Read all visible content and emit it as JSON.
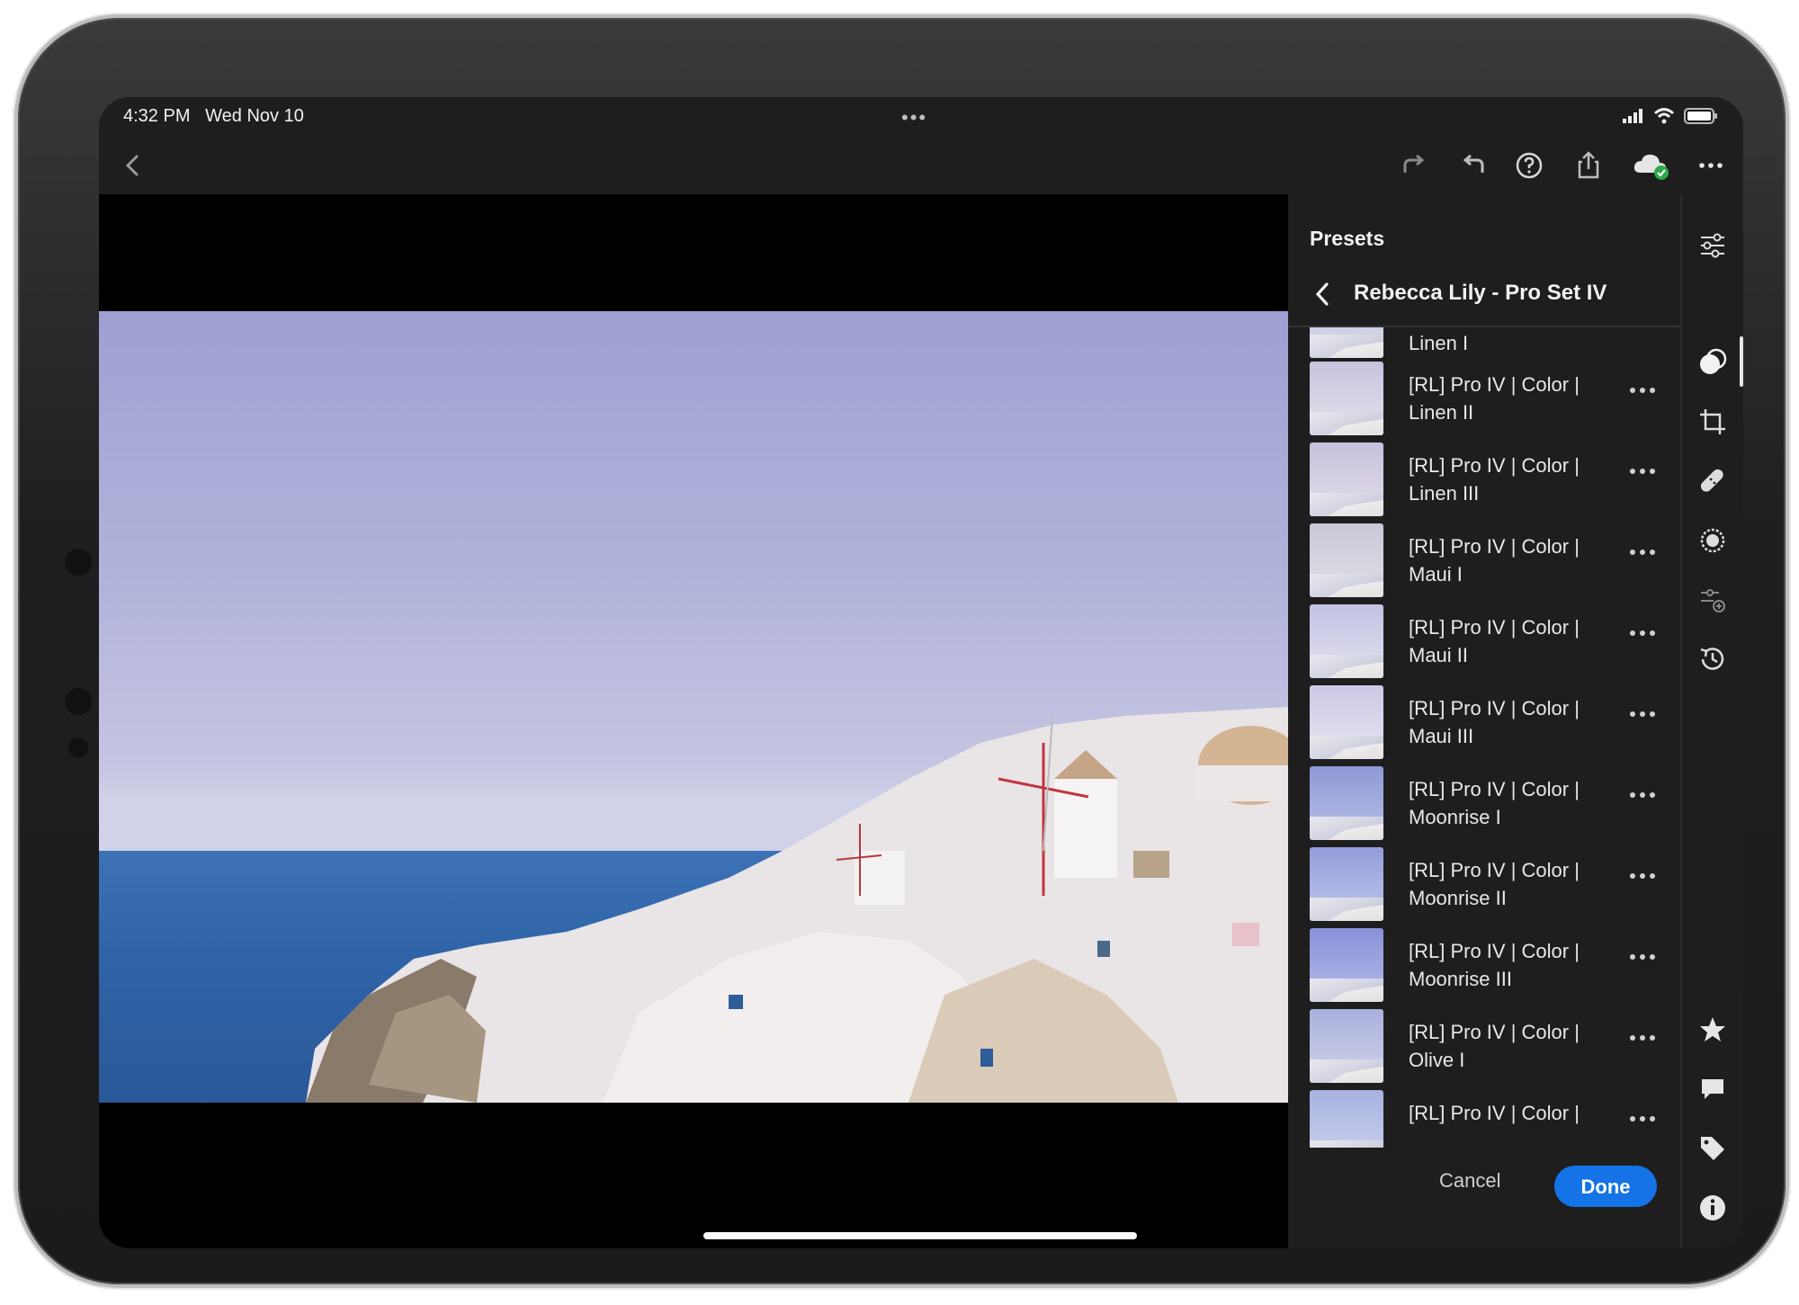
{
  "status_bar": {
    "time": "4:32 PM",
    "date": "Wed Nov 10",
    "dots": "•••"
  },
  "toolbar": {
    "icons": [
      "back-chevron-icon",
      "redo-icon",
      "undo-icon",
      "help-icon",
      "share-icon",
      "cloud-synced-icon",
      "more-icon"
    ]
  },
  "panel": {
    "title": "Presets",
    "group_name": "Rebecca Lily - Pro Set IV",
    "items": [
      {
        "label": "Linen I"
      },
      {
        "label": "[RL] Pro IV | Color | Linen II"
      },
      {
        "label": "[RL] Pro IV | Color | Linen III"
      },
      {
        "label": "[RL] Pro IV | Color | Maui I"
      },
      {
        "label": "[RL] Pro IV | Color | Maui II"
      },
      {
        "label": "[RL] Pro IV | Color | Maui III"
      },
      {
        "label": "[RL] Pro IV | Color | Moonrise I"
      },
      {
        "label": "[RL] Pro IV | Color | Moonrise II"
      },
      {
        "label": "[RL] Pro IV | Color | Moonrise III"
      },
      {
        "label": "[RL] Pro IV | Color | Olive I"
      },
      {
        "label": "[RL] Pro IV | Color |"
      }
    ],
    "cancel_label": "Cancel",
    "done_label": "Done"
  },
  "rail": {
    "icons": [
      "edit-sliders-icon",
      "presets-icon",
      "crop-icon",
      "healing-icon",
      "masking-icon",
      "versions-icon",
      "history-icon",
      "rating-star-icon",
      "comment-icon",
      "keyword-tag-icon",
      "info-icon"
    ],
    "active": "presets-icon"
  },
  "colors": {
    "accent": "#1473e6",
    "panel_bg": "#1e1e1e",
    "canvas_bg": "#000000"
  }
}
